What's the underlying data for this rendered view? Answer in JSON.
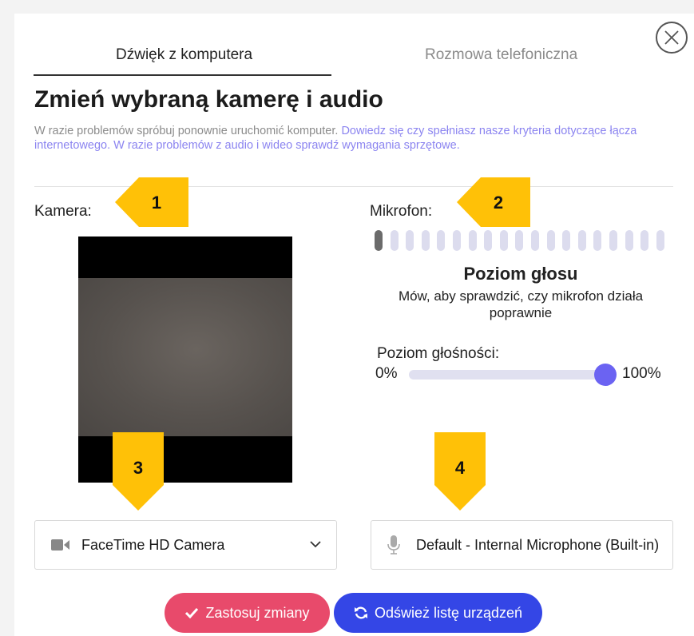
{
  "tabs": [
    {
      "label": "Dźwięk z komputera",
      "active": true
    },
    {
      "label": "Rozmowa telefoniczna",
      "active": false
    }
  ],
  "title": "Zmień wybraną kamerę i audio",
  "description": {
    "text": "W razie problemów spróbuj ponownie uruchomić komputer.",
    "link_text": "Dowiedz się czy spełniasz nasze kryteria dotyczące łącza internetowego. W razie problemów z audio i wideo sprawdź wymagania sprzętowe."
  },
  "camera": {
    "label": "Kamera:",
    "selected": "FaceTime HD Camera"
  },
  "microphone": {
    "label": "Mikrofon:",
    "selected": "Default - Internal Microphone (Built-in)",
    "meter_active_segments": 1,
    "meter_total_segments": 19,
    "level_title": "Poziom głosu",
    "level_description": "Mów, aby sprawdzić, czy mikrofon działa poprawnie",
    "volume_label": "Poziom głośności:",
    "volume_min": "0%",
    "volume_max": "100%",
    "volume_value": 1.0
  },
  "callouts": [
    "1",
    "2",
    "3",
    "4"
  ],
  "buttons": {
    "apply": "Zastosuj zmiany",
    "refresh": "Odśwież listę urządzeń"
  },
  "colors": {
    "accent": "#6b63f2",
    "apply_button": "#e84a6b",
    "refresh_button": "#3446e6",
    "link": "#8b84f0",
    "callout": "#ffc107"
  },
  "icons": {
    "close": "close-circle-icon",
    "camera": "video-camera-icon",
    "microphone": "microphone-icon",
    "chevron": "chevron-down-icon",
    "apply": "checkmark-icon",
    "refresh": "refresh-icon"
  }
}
